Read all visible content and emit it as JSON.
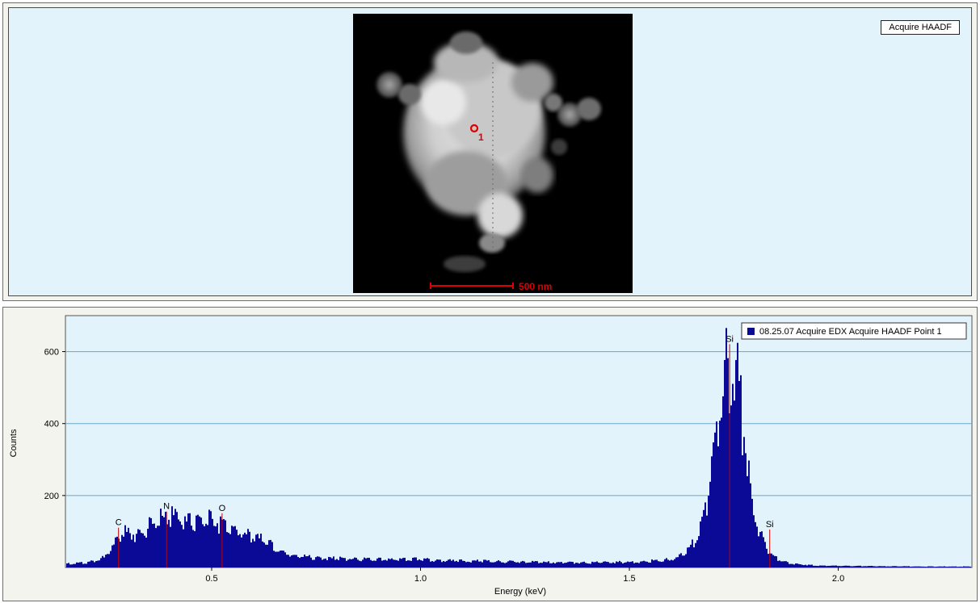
{
  "image_panel": {
    "acquire_label": "Acquire HAADF",
    "scale_bar_label": "500 nm",
    "point_label": "1"
  },
  "colors": {
    "panel_bg": "#e2f3fb",
    "image_bg": "#000000",
    "marker": "#cc0000",
    "bar_fill": "#0a0a96",
    "peak_line": "#c00000",
    "grid": "#6aa7c8"
  },
  "chart_data": {
    "type": "bar",
    "xlabel": "Energy (keV)",
    "ylabel": "Counts",
    "xlim": [
      0.15,
      2.32
    ],
    "ylim": [
      0,
      700
    ],
    "xticks": [
      0.5,
      1.0,
      1.5,
      2.0
    ],
    "xtick_labels": [
      "0.5",
      "1.0",
      "1.5",
      "2.0"
    ],
    "yticks": [
      200,
      400,
      600
    ],
    "ytick_labels": [
      "200",
      "400",
      "600"
    ],
    "grid": true,
    "legend": {
      "position": "top-right",
      "entries": [
        {
          "name": "08.25.07 Acquire EDX Acquire HAADF Point 1"
        }
      ]
    },
    "series": [
      {
        "name": "08.25.07 Acquire EDX Acquire HAADF Point 1",
        "x": [
          0.16,
          0.2,
          0.24,
          0.26,
          0.28,
          0.3,
          0.32,
          0.34,
          0.36,
          0.38,
          0.4,
          0.42,
          0.44,
          0.46,
          0.48,
          0.5,
          0.52,
          0.54,
          0.56,
          0.58,
          0.6,
          0.62,
          0.64,
          0.66,
          0.7,
          0.75,
          0.8,
          0.85,
          0.9,
          0.95,
          1.0,
          1.05,
          1.1,
          1.15,
          1.2,
          1.25,
          1.3,
          1.35,
          1.4,
          1.45,
          1.5,
          1.55,
          1.6,
          1.62,
          1.64,
          1.66,
          1.68,
          1.69,
          1.7,
          1.71,
          1.72,
          1.73,
          1.74,
          1.75,
          1.76,
          1.77,
          1.78,
          1.79,
          1.8,
          1.81,
          1.82,
          1.83,
          1.84,
          1.86,
          1.88,
          1.9,
          1.95,
          2.0,
          2.1,
          2.2,
          2.32
        ],
        "values": [
          12,
          15,
          30,
          60,
          105,
          110,
          100,
          115,
          140,
          150,
          155,
          150,
          140,
          140,
          145,
          145,
          138,
          125,
          110,
          100,
          95,
          85,
          70,
          50,
          35,
          30,
          28,
          26,
          25,
          24,
          26,
          22,
          20,
          20,
          18,
          17,
          16,
          15,
          15,
          16,
          17,
          20,
          25,
          35,
          55,
          95,
          180,
          260,
          360,
          480,
          580,
          610,
          620,
          600,
          550,
          450,
          320,
          220,
          160,
          110,
          80,
          55,
          35,
          22,
          14,
          10,
          6,
          5,
          4,
          3,
          3
        ]
      }
    ],
    "peak_markers": [
      {
        "element": "C",
        "energy": 0.277,
        "label_value": 115
      },
      {
        "element": "N",
        "energy": 0.392,
        "label_value": 160
      },
      {
        "element": "O",
        "energy": 0.525,
        "label_value": 155
      },
      {
        "element": "Si",
        "energy": 1.74,
        "label_value": 625
      },
      {
        "element": "Si",
        "energy": 1.836,
        "label_value": 110
      }
    ]
  }
}
